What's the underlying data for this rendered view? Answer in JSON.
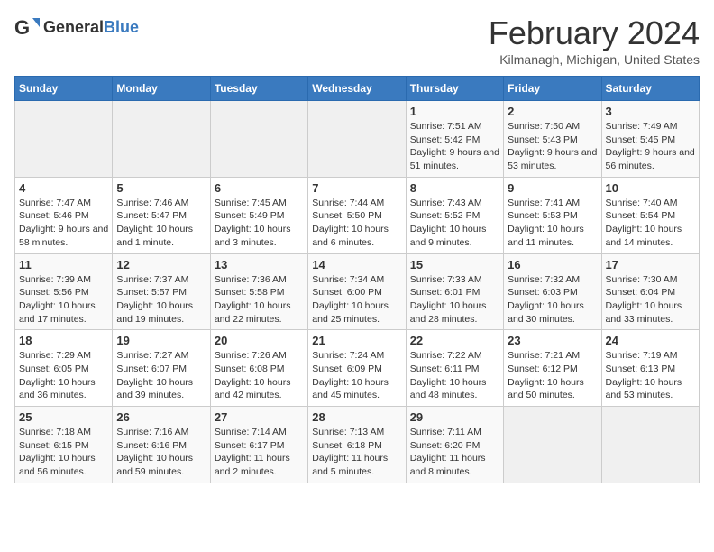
{
  "header": {
    "logo_general": "General",
    "logo_blue": "Blue",
    "month_title": "February 2024",
    "location": "Kilmanagh, Michigan, United States"
  },
  "calendar": {
    "days_of_week": [
      "Sunday",
      "Monday",
      "Tuesday",
      "Wednesday",
      "Thursday",
      "Friday",
      "Saturday"
    ],
    "weeks": [
      [
        {
          "day": "",
          "info": ""
        },
        {
          "day": "",
          "info": ""
        },
        {
          "day": "",
          "info": ""
        },
        {
          "day": "",
          "info": ""
        },
        {
          "day": "1",
          "info": "Sunrise: 7:51 AM\nSunset: 5:42 PM\nDaylight: 9 hours and 51 minutes."
        },
        {
          "day": "2",
          "info": "Sunrise: 7:50 AM\nSunset: 5:43 PM\nDaylight: 9 hours and 53 minutes."
        },
        {
          "day": "3",
          "info": "Sunrise: 7:49 AM\nSunset: 5:45 PM\nDaylight: 9 hours and 56 minutes."
        }
      ],
      [
        {
          "day": "4",
          "info": "Sunrise: 7:47 AM\nSunset: 5:46 PM\nDaylight: 9 hours and 58 minutes."
        },
        {
          "day": "5",
          "info": "Sunrise: 7:46 AM\nSunset: 5:47 PM\nDaylight: 10 hours and 1 minute."
        },
        {
          "day": "6",
          "info": "Sunrise: 7:45 AM\nSunset: 5:49 PM\nDaylight: 10 hours and 3 minutes."
        },
        {
          "day": "7",
          "info": "Sunrise: 7:44 AM\nSunset: 5:50 PM\nDaylight: 10 hours and 6 minutes."
        },
        {
          "day": "8",
          "info": "Sunrise: 7:43 AM\nSunset: 5:52 PM\nDaylight: 10 hours and 9 minutes."
        },
        {
          "day": "9",
          "info": "Sunrise: 7:41 AM\nSunset: 5:53 PM\nDaylight: 10 hours and 11 minutes."
        },
        {
          "day": "10",
          "info": "Sunrise: 7:40 AM\nSunset: 5:54 PM\nDaylight: 10 hours and 14 minutes."
        }
      ],
      [
        {
          "day": "11",
          "info": "Sunrise: 7:39 AM\nSunset: 5:56 PM\nDaylight: 10 hours and 17 minutes."
        },
        {
          "day": "12",
          "info": "Sunrise: 7:37 AM\nSunset: 5:57 PM\nDaylight: 10 hours and 19 minutes."
        },
        {
          "day": "13",
          "info": "Sunrise: 7:36 AM\nSunset: 5:58 PM\nDaylight: 10 hours and 22 minutes."
        },
        {
          "day": "14",
          "info": "Sunrise: 7:34 AM\nSunset: 6:00 PM\nDaylight: 10 hours and 25 minutes."
        },
        {
          "day": "15",
          "info": "Sunrise: 7:33 AM\nSunset: 6:01 PM\nDaylight: 10 hours and 28 minutes."
        },
        {
          "day": "16",
          "info": "Sunrise: 7:32 AM\nSunset: 6:03 PM\nDaylight: 10 hours and 30 minutes."
        },
        {
          "day": "17",
          "info": "Sunrise: 7:30 AM\nSunset: 6:04 PM\nDaylight: 10 hours and 33 minutes."
        }
      ],
      [
        {
          "day": "18",
          "info": "Sunrise: 7:29 AM\nSunset: 6:05 PM\nDaylight: 10 hours and 36 minutes."
        },
        {
          "day": "19",
          "info": "Sunrise: 7:27 AM\nSunset: 6:07 PM\nDaylight: 10 hours and 39 minutes."
        },
        {
          "day": "20",
          "info": "Sunrise: 7:26 AM\nSunset: 6:08 PM\nDaylight: 10 hours and 42 minutes."
        },
        {
          "day": "21",
          "info": "Sunrise: 7:24 AM\nSunset: 6:09 PM\nDaylight: 10 hours and 45 minutes."
        },
        {
          "day": "22",
          "info": "Sunrise: 7:22 AM\nSunset: 6:11 PM\nDaylight: 10 hours and 48 minutes."
        },
        {
          "day": "23",
          "info": "Sunrise: 7:21 AM\nSunset: 6:12 PM\nDaylight: 10 hours and 50 minutes."
        },
        {
          "day": "24",
          "info": "Sunrise: 7:19 AM\nSunset: 6:13 PM\nDaylight: 10 hours and 53 minutes."
        }
      ],
      [
        {
          "day": "25",
          "info": "Sunrise: 7:18 AM\nSunset: 6:15 PM\nDaylight: 10 hours and 56 minutes."
        },
        {
          "day": "26",
          "info": "Sunrise: 7:16 AM\nSunset: 6:16 PM\nDaylight: 10 hours and 59 minutes."
        },
        {
          "day": "27",
          "info": "Sunrise: 7:14 AM\nSunset: 6:17 PM\nDaylight: 11 hours and 2 minutes."
        },
        {
          "day": "28",
          "info": "Sunrise: 7:13 AM\nSunset: 6:18 PM\nDaylight: 11 hours and 5 minutes."
        },
        {
          "day": "29",
          "info": "Sunrise: 7:11 AM\nSunset: 6:20 PM\nDaylight: 11 hours and 8 minutes."
        },
        {
          "day": "",
          "info": ""
        },
        {
          "day": "",
          "info": ""
        }
      ]
    ]
  }
}
